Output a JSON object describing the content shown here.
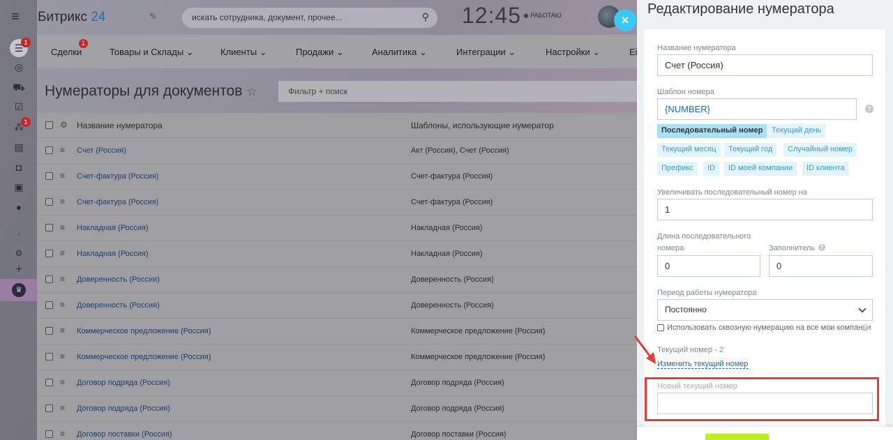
{
  "header": {
    "brand": "Битрикс",
    "brand_num": "24",
    "search_placeholder": "искать сотрудника, документ, прочее...",
    "clock": "12:45",
    "work_status": "РАБОТАЮ"
  },
  "rail": {
    "badges": [
      "1",
      "1"
    ]
  },
  "menu": {
    "items": [
      "Сделки",
      "Товары и Склады",
      "Клиенты",
      "Продажи",
      "Аналитика",
      "Интеграции",
      "Настройки",
      "Еі"
    ],
    "deals_badge": "1"
  },
  "page": {
    "title": "Нумераторы для документов",
    "filter_placeholder": "Фильтр + поиск"
  },
  "grid": {
    "columns": [
      "Название нумератора",
      "Шаблоны, использующие нумератор"
    ],
    "rows": [
      {
        "name": "Счет (Россия)",
        "templates": "Акт (Россия), Счет (Россия)"
      },
      {
        "name": "Счет-фактура (Россия)",
        "templates": "Счет-фактура (Россия)"
      },
      {
        "name": "Счет-фактура (Россия)",
        "templates": "Счет-фактура (Россия)"
      },
      {
        "name": "Накладная (Россия)",
        "templates": "Накладная (Россия)"
      },
      {
        "name": "Накладная (Россия)",
        "templates": "Накладная (Россия)"
      },
      {
        "name": "Доверенность (Россия)",
        "templates": "Доверенность (Россия)"
      },
      {
        "name": "Доверенность (Россия)",
        "templates": "Доверенность (Россия)"
      },
      {
        "name": "Коммерческое предложение (Россия)",
        "templates": "Коммерческое предложение (Россия)"
      },
      {
        "name": "Коммерческое предложение (Россия)",
        "templates": "Коммерческое предложение (Россия)"
      },
      {
        "name": "Договор подряда (Россия)",
        "templates": "Договор подряда (Россия)"
      },
      {
        "name": "Договор подряда (Россия)",
        "templates": "Договор подряда (Россия)"
      },
      {
        "name": "Договор поставки (Россия)",
        "templates": "Договор поставки (Россия)"
      }
    ]
  },
  "panel": {
    "title": "Редактирование нумератора",
    "name_label": "Название нумератора",
    "name_value": "Счет (Россия)",
    "template_label": "Шаблон номера",
    "template_value": "{NUMBER}",
    "tags": [
      "Последовательный номер",
      "Текущий день",
      "Текущий месяц",
      "Текущий год",
      "Случайный номер",
      "Префикс",
      "ID",
      "ID моей компании",
      "ID клиента"
    ],
    "increment_label": "Увеличивать последовательный номер на",
    "increment_value": "1",
    "length_label_1": "Длина последовательного",
    "length_label_2": "номера",
    "length_value": "0",
    "filler_label": "Заполнитель",
    "filler_value": "0",
    "period_label": "Период работы нумератора",
    "period_value": "Постоянно",
    "through_numbering": "Использовать сквозную нумерацию на все мои компании",
    "current_number": "Текущий номер - 2",
    "change_link": "Изменить текущий номер",
    "new_number_label": "Новый текущий номер",
    "new_number_value": ""
  }
}
